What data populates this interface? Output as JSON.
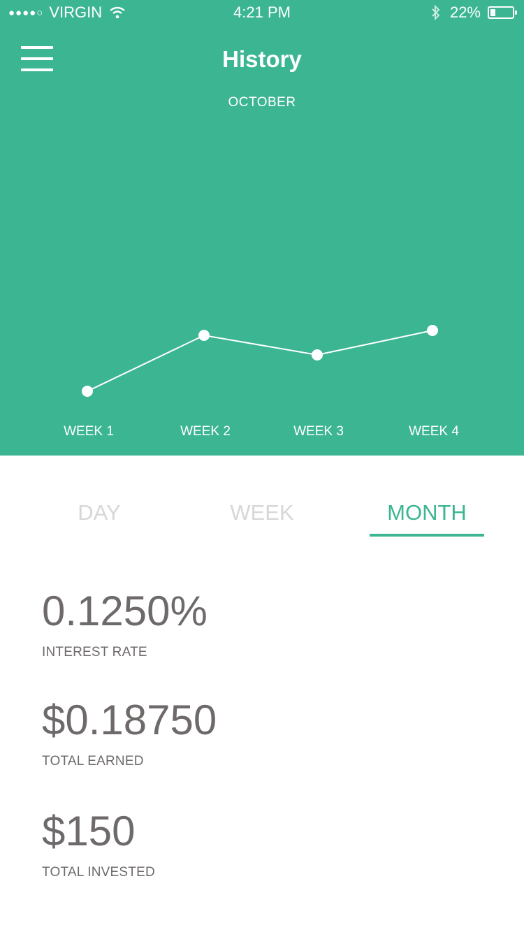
{
  "status_bar": {
    "signal": "●●●●○",
    "carrier": "VIRGIN",
    "wifi_icon": "wifi-icon",
    "time": "4:21 PM",
    "bluetooth_icon": "bluetooth-icon",
    "battery_percent": "22%",
    "battery_level": 0.22
  },
  "header": {
    "menu_icon": "hamburger-menu-icon",
    "title": "History",
    "period": "OCTOBER"
  },
  "chart_data": {
    "type": "line",
    "categories": [
      "WEEK 1",
      "WEEK 2",
      "WEEK 3",
      "WEEK 4"
    ],
    "series": [
      {
        "values": [
          0.2,
          1.0,
          0.72,
          1.07
        ]
      }
    ],
    "ylim": [
      0,
      1.6
    ],
    "grid": false,
    "line_color": "#ffffff",
    "background_color": "#3bb592"
  },
  "tabs": {
    "items": [
      {
        "label": "DAY",
        "active": false
      },
      {
        "label": "WEEK",
        "active": false
      },
      {
        "label": "MONTH",
        "active": true
      }
    ]
  },
  "stats": [
    {
      "value": "0.1250%",
      "label": "INTEREST RATE"
    },
    {
      "value": "$0.18750",
      "label": "TOTAL EARNED"
    },
    {
      "value": "$150",
      "label": "TOTAL INVESTED"
    }
  ],
  "colors": {
    "accent": "#3bb592",
    "inactive_tab": "#d7d7d7",
    "stat_text": "#6f6a6a"
  }
}
